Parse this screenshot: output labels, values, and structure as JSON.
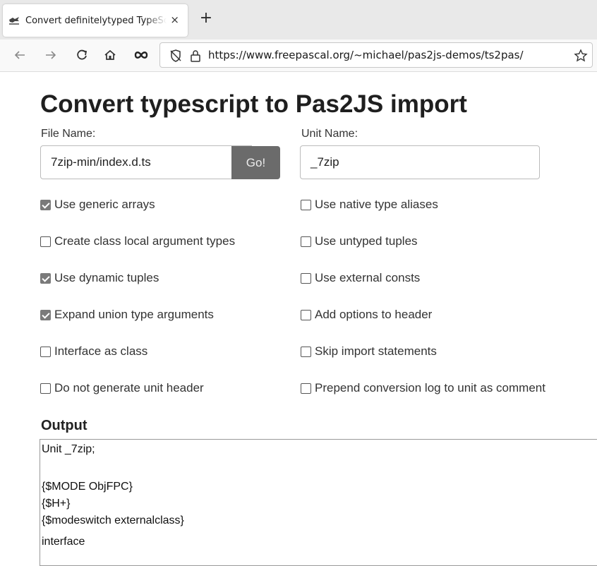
{
  "browser": {
    "tab_title": "Convert definitelytyped TypeScript",
    "tab_close": "×",
    "new_tab": "+",
    "url": "https://www.freepascal.org/~michael/pas2js-demos/ts2pas/"
  },
  "page": {
    "title": "Convert typescript to Pas2JS import",
    "file_name_label": "File Name:",
    "file_name_value": "7zip-min/index.d.ts",
    "go_label": "Go!",
    "unit_name_label": "Unit Name:",
    "unit_name_value": "_7zip",
    "options_left": [
      {
        "label": "Use generic arrays",
        "checked": true
      },
      {
        "label": "Create class local argument types",
        "checked": false
      },
      {
        "label": "Use dynamic tuples",
        "checked": true
      },
      {
        "label": "Expand union type arguments",
        "checked": true
      },
      {
        "label": "Interface as class",
        "checked": false
      },
      {
        "label": "Do not generate unit header",
        "checked": false
      }
    ],
    "options_right": [
      {
        "label": "Use native type aliases",
        "checked": false
      },
      {
        "label": "Use untyped tuples",
        "checked": false
      },
      {
        "label": "Use external consts",
        "checked": false
      },
      {
        "label": "Add options to header",
        "checked": false
      },
      {
        "label": "Skip import statements",
        "checked": false
      },
      {
        "label": "Prepend conversion log to unit as comment",
        "checked": false
      }
    ],
    "output_heading": "Output",
    "output_lines": [
      "Unit _7zip;",
      "{$MODE ObjFPC}",
      "{$H+}",
      "{$modeswitch externalclass}",
      "interface"
    ]
  }
}
